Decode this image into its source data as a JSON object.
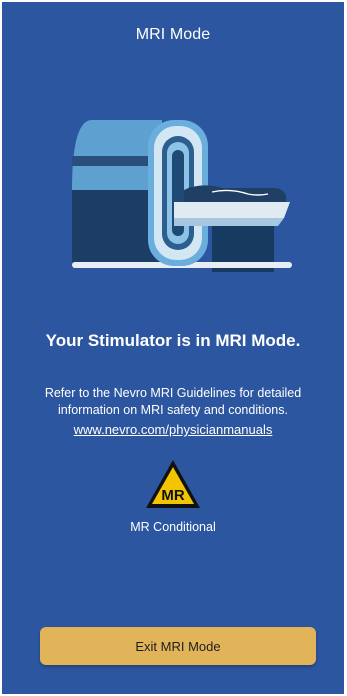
{
  "header": {
    "title": "MRI Mode"
  },
  "illustration": {
    "icon": "mri-scanner-illustration"
  },
  "main": {
    "status_text": "Your Stimulator is in MRI Mode.",
    "guidelines_text": "Refer to the Nevro MRI Guidelines for detailed information on MRI safety and conditions.",
    "link_text": "www.nevro.com/physicianmanuals",
    "mr_badge_text": "MR",
    "mr_caption": "MR Conditional"
  },
  "footer": {
    "exit_label": "Exit MRI Mode"
  },
  "colors": {
    "background": "#2c56a0",
    "button": "#e2b45a",
    "badge": "#f2c500"
  }
}
